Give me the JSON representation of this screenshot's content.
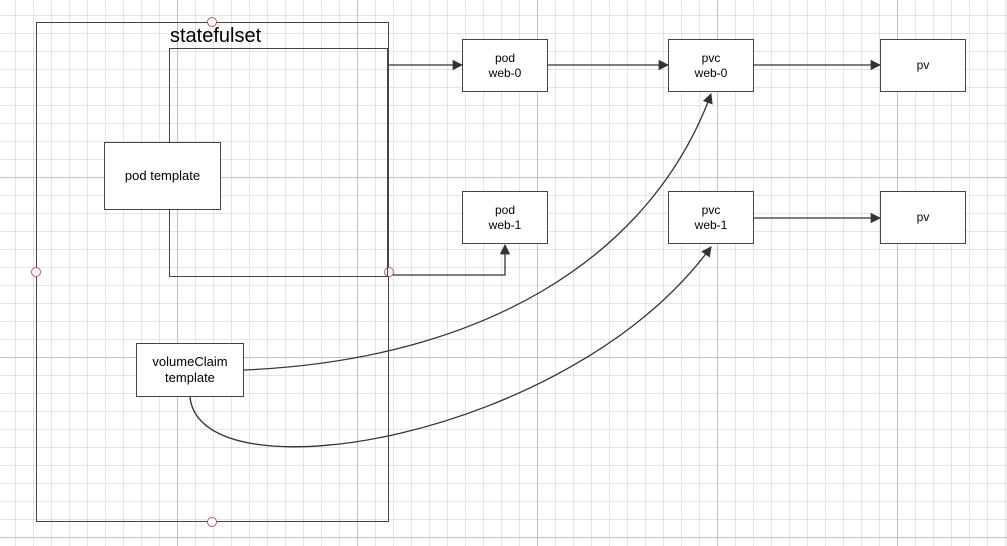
{
  "title": "statefulset",
  "nodes": {
    "pod_template": "pod template",
    "volume_claim_template_l1": "volumeClaim",
    "volume_claim_template_l2": "template",
    "pod_web0_l1": "pod",
    "pod_web0_l2": "web-0",
    "pod_web1_l1": "pod",
    "pod_web1_l2": "web-1",
    "pvc_web0_l1": "pvc",
    "pvc_web0_l2": "web-0",
    "pvc_web1_l1": "pvc",
    "pvc_web1_l2": "web-1",
    "pv0": "pv",
    "pv1": "pv"
  },
  "edges": [
    {
      "from": "pod-template-frame",
      "to": "pod-web-0",
      "kind": "right"
    },
    {
      "from": "pod-template-frame",
      "to": "pod-web-1",
      "kind": "elbow"
    },
    {
      "from": "pod-web-0",
      "to": "pvc-web-0",
      "kind": "right"
    },
    {
      "from": "pvc-web-0",
      "to": "pv-0",
      "kind": "right"
    },
    {
      "from": "pvc-web-1",
      "to": "pv-1",
      "kind": "right"
    },
    {
      "from": "volume-claim-template",
      "to": "pvc-web-0",
      "kind": "curve-up"
    },
    {
      "from": "volume-claim-template",
      "to": "pvc-web-1",
      "kind": "curve-up"
    }
  ],
  "colors": {
    "stroke": "#333333",
    "handle": "#d9534f",
    "grid": "#e5e5e5"
  }
}
